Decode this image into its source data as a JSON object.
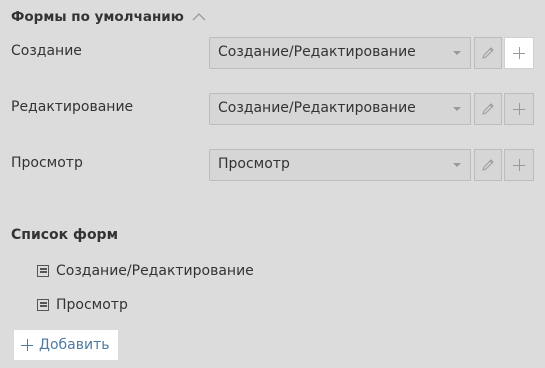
{
  "section": {
    "title": "Формы по умолчанию"
  },
  "default_forms": [
    {
      "label": "Создание",
      "value": "Создание/Редактирование"
    },
    {
      "label": "Редактирование",
      "value": "Создание/Редактирование"
    },
    {
      "label": "Просмотр",
      "value": "Просмотр"
    }
  ],
  "forms_list": {
    "title": "Список форм",
    "items": [
      "Создание/Редактирование",
      "Просмотр"
    ],
    "add_label": "Добавить"
  },
  "icons": {
    "collapse": "chevron-up-icon",
    "caret": "chevron-down-icon",
    "edit": "pencil-icon",
    "add": "plus-icon",
    "form": "form-icon"
  },
  "colors": {
    "background": "#dcdcdc",
    "link": "#4d7aa6",
    "text": "#333333"
  }
}
